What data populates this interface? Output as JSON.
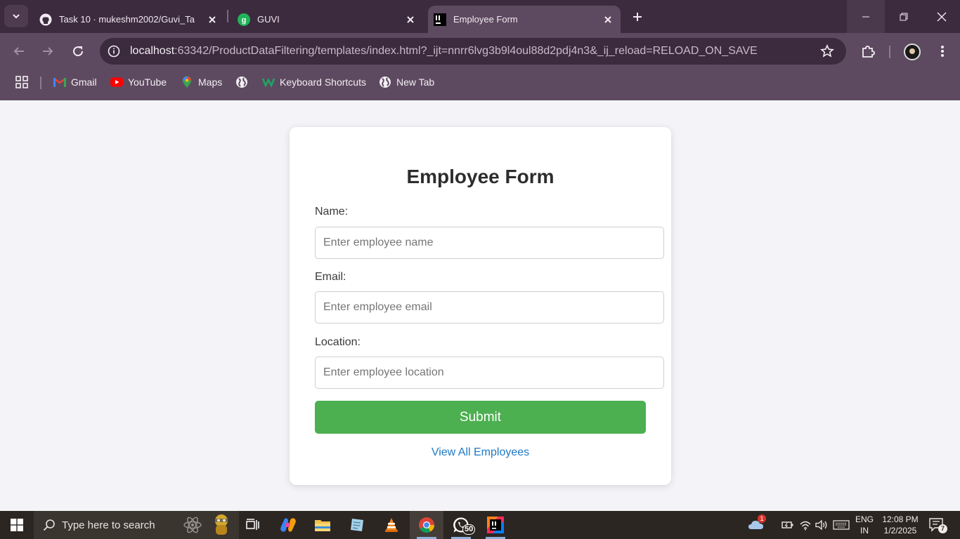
{
  "browser": {
    "tabs": [
      {
        "title": "Task 10 · mukeshm2002/Guvi_Ta",
        "icon": "github-icon"
      },
      {
        "title": "GUVI",
        "icon": "guvi-icon"
      },
      {
        "title": "Employee Form",
        "icon": "intellij-icon",
        "active": true
      }
    ],
    "url_host": "localhost",
    "url_rest": ":63342/ProductDataFiltering/templates/index.html?_ijt=nnrr6lvg3b9l4oul88d2pdj4n3&_ij_reload=RELOAD_ON_SAVE",
    "bookmarks": [
      {
        "label": "Gmail",
        "icon": "gmail-icon"
      },
      {
        "label": "YouTube",
        "icon": "youtube-icon"
      },
      {
        "label": "Maps",
        "icon": "maps-icon"
      },
      {
        "label": "",
        "icon": "globe-icon"
      },
      {
        "label": "Keyboard Shortcuts",
        "icon": "keyboard-shortcuts-icon"
      },
      {
        "label": "New Tab",
        "icon": "globe-icon"
      }
    ]
  },
  "form": {
    "title": "Employee Form",
    "name_label": "Name:",
    "name_placeholder": "Enter employee name",
    "email_label": "Email:",
    "email_placeholder": "Enter employee email",
    "location_label": "Location:",
    "location_placeholder": "Enter employee location",
    "submit_label": "Submit",
    "view_all_label": "View All Employees",
    "accent_color": "#4caf50",
    "link_color": "#1f78c4"
  },
  "taskbar": {
    "search_placeholder": "Type here to search",
    "whatsapp_badge": "50",
    "weather_badge": "1",
    "lang_line1": "ENG",
    "lang_line2": "IN",
    "time": "12:08 PM",
    "date": "1/2/2025",
    "notification_count": "7"
  }
}
